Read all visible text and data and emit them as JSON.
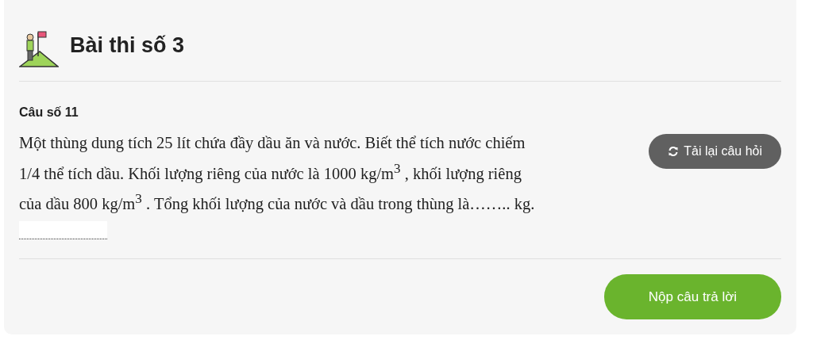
{
  "header": {
    "title": "Bài thi số 3"
  },
  "question": {
    "number": "Câu số 11",
    "text": "Một thùng dung tích 25 lít chứa đầy dầu ăn và nước. Biết thể tích nước chiếm 1/4 thể tích dầu. Khối lượng riêng của nước là 1000 kg/m$^{3}$ , khối lượng riêng của dầu 800 kg/m$^{3}$ . Tổng khối lượng của nước và dầu trong thùng là…….. kg.",
    "reload_button": "Tải lại câu hỏi"
  },
  "submit_button": "Nộp câu trả lời"
}
